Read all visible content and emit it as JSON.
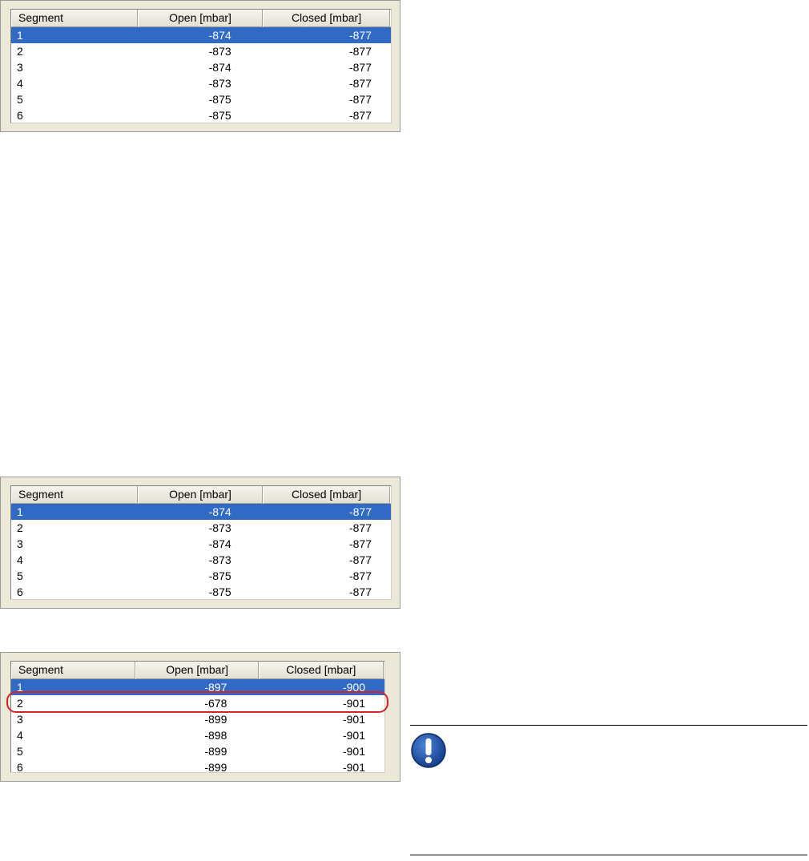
{
  "table": {
    "columns": [
      "Segment",
      "Open [mbar]",
      "Closed [mbar]"
    ]
  },
  "table1": {
    "rows": [
      {
        "segment": "1",
        "open": "-874",
        "closed": "-877",
        "selected": true
      },
      {
        "segment": "2",
        "open": "-873",
        "closed": "-877",
        "selected": false
      },
      {
        "segment": "3",
        "open": "-874",
        "closed": "-877",
        "selected": false
      },
      {
        "segment": "4",
        "open": "-873",
        "closed": "-877",
        "selected": false
      },
      {
        "segment": "5",
        "open": "-875",
        "closed": "-877",
        "selected": false
      },
      {
        "segment": "6",
        "open": "-875",
        "closed": "-877",
        "selected": false
      }
    ]
  },
  "table2": {
    "rows": [
      {
        "segment": "1",
        "open": "-874",
        "closed": "-877",
        "selected": true
      },
      {
        "segment": "2",
        "open": "-873",
        "closed": "-877",
        "selected": false
      },
      {
        "segment": "3",
        "open": "-874",
        "closed": "-877",
        "selected": false
      },
      {
        "segment": "4",
        "open": "-873",
        "closed": "-877",
        "selected": false
      },
      {
        "segment": "5",
        "open": "-875",
        "closed": "-877",
        "selected": false
      },
      {
        "segment": "6",
        "open": "-875",
        "closed": "-877",
        "selected": false
      }
    ]
  },
  "table3": {
    "rows": [
      {
        "segment": "1",
        "open": "-897",
        "closed": "-900",
        "selected": true
      },
      {
        "segment": "2",
        "open": "-678",
        "closed": "-901",
        "selected": false,
        "highlighted": true
      },
      {
        "segment": "3",
        "open": "-899",
        "closed": "-901",
        "selected": false
      },
      {
        "segment": "4",
        "open": "-898",
        "closed": "-901",
        "selected": false
      },
      {
        "segment": "5",
        "open": "-899",
        "closed": "-901",
        "selected": false
      },
      {
        "segment": "6",
        "open": "-899",
        "closed": "-901",
        "selected": false
      }
    ]
  },
  "colors": {
    "selection": "#316ac5",
    "highlight_ring": "#d6222b",
    "notice_icon": "#1f4fa8"
  },
  "icons": {
    "notice": "exclamation-icon"
  }
}
